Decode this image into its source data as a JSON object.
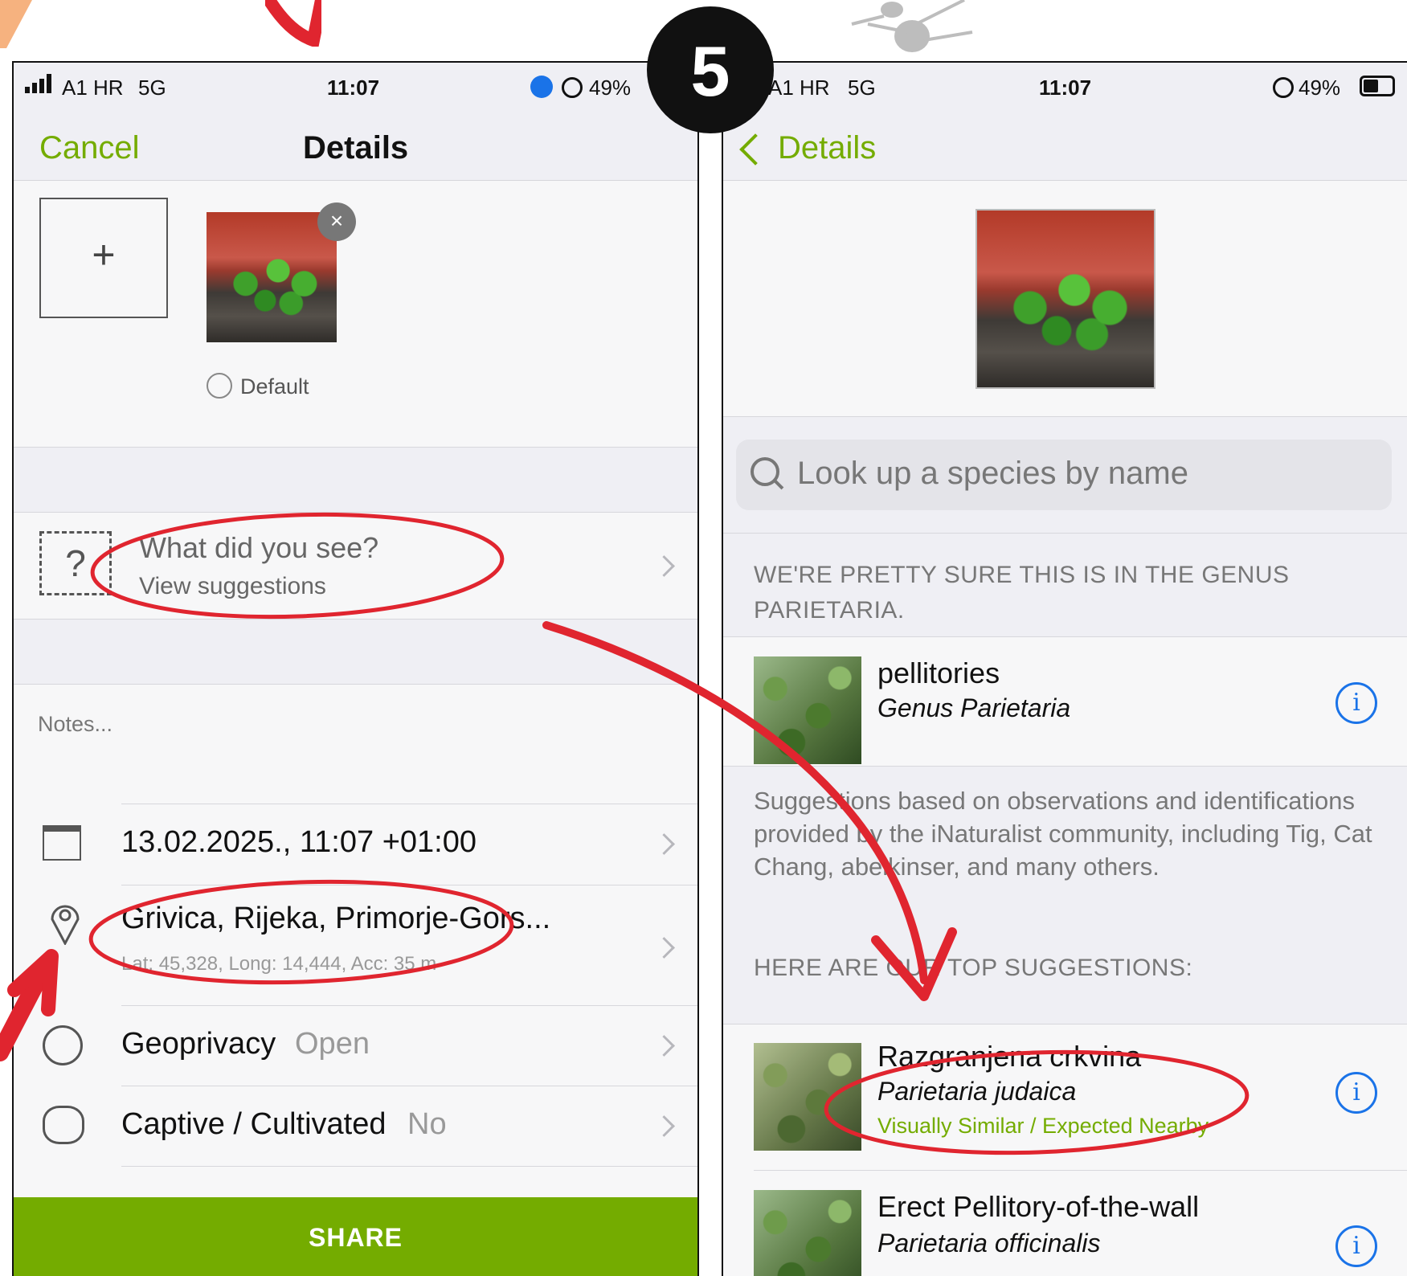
{
  "step_badge": "5",
  "left": {
    "status": {
      "carrier": "A1 HR",
      "network": "5G",
      "time": "11:07",
      "battery": "49%"
    },
    "nav": {
      "cancel": "Cancel",
      "title": "Details"
    },
    "photo": {
      "default_label": "Default"
    },
    "species_prompt": {
      "title": "What did you see?",
      "subtitle": "View suggestions"
    },
    "notes_placeholder": "Notes...",
    "datetime": "13.02.2025., 11:07 +01:00",
    "location": {
      "name": "Grivica, Rijeka, Primorje-Gors...",
      "coords": "Lat: 45,328, Long: 14,444, Acc: 35 m"
    },
    "geoprivacy": {
      "label": "Geoprivacy",
      "value": "Open"
    },
    "captive": {
      "label": "Captive / Cultivated",
      "value": "No"
    },
    "share_button": "SHARE"
  },
  "right": {
    "status": {
      "carrier": "A1 HR",
      "network": "5G",
      "time": "11:07",
      "battery": "49%"
    },
    "nav": {
      "back": "Details"
    },
    "search_placeholder": "Look up a species by name",
    "genus_header": "WE'RE PRETTY SURE THIS IS IN THE GENUS PARIETARIA.",
    "genus_result": {
      "common": "pellitories",
      "scientific": "Genus Parietaria"
    },
    "credits": "Suggestions based on observations and identifications provided by the iNaturalist community, including Tig, Cat Chang, abelkinser, and many others.",
    "top_header": "HERE ARE OUR TOP SUGGESTIONS:",
    "suggestions": [
      {
        "common": "Razgranjena crkvina",
        "scientific": "Parietaria judaica",
        "tag": "Visually Similar / Expected Nearby"
      },
      {
        "common": "Erect Pellitory-of-the-wall",
        "scientific": "Parietaria officinalis"
      }
    ]
  },
  "colors": {
    "accent_green": "#74ac00",
    "annotation_red": "#e0252f",
    "info_blue": "#1a73e8"
  }
}
